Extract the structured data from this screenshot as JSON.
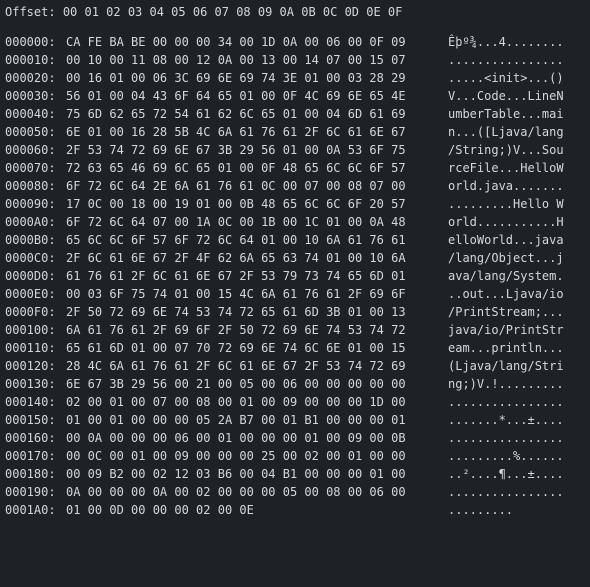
{
  "header": {
    "label": "Offset:",
    "columns": "00 01 02 03 04 05 06 07 08 09 0A 0B 0C 0D 0E 0F"
  },
  "rows": [
    {
      "offset": "000000:",
      "hex": "CA FE BA BE 00 00 00 34 00 1D 0A 00 06 00 0F 09",
      "ascii": "Êþº¾...4........"
    },
    {
      "offset": "000010:",
      "hex": "00 10 00 11 08 00 12 0A 00 13 00 14 07 00 15 07",
      "ascii": "................"
    },
    {
      "offset": "000020:",
      "hex": "00 16 01 00 06 3C 69 6E 69 74 3E 01 00 03 28 29",
      "ascii": ".....<init>...()"
    },
    {
      "offset": "000030:",
      "hex": "56 01 00 04 43 6F 64 65 01 00 0F 4C 69 6E 65 4E",
      "ascii": "V...Code...LineN"
    },
    {
      "offset": "000040:",
      "hex": "75 6D 62 65 72 54 61 62 6C 65 01 00 04 6D 61 69",
      "ascii": "umberTable...mai"
    },
    {
      "offset": "000050:",
      "hex": "6E 01 00 16 28 5B 4C 6A 61 76 61 2F 6C 61 6E 67",
      "ascii": "n...([Ljava/lang"
    },
    {
      "offset": "000060:",
      "hex": "2F 53 74 72 69 6E 67 3B 29 56 01 00 0A 53 6F 75",
      "ascii": "/String;)V...Sou"
    },
    {
      "offset": "000070:",
      "hex": "72 63 65 46 69 6C 65 01 00 0F 48 65 6C 6C 6F 57",
      "ascii": "rceFile...HelloW"
    },
    {
      "offset": "000080:",
      "hex": "6F 72 6C 64 2E 6A 61 76 61 0C 00 07 00 08 07 00",
      "ascii": "orld.java......."
    },
    {
      "offset": "000090:",
      "hex": "17 0C 00 18 00 19 01 00 0B 48 65 6C 6C 6F 20 57",
      "ascii": ".........Hello W"
    },
    {
      "offset": "0000A0:",
      "hex": "6F 72 6C 64 07 00 1A 0C 00 1B 00 1C 01 00 0A 48",
      "ascii": "orld...........H"
    },
    {
      "offset": "0000B0:",
      "hex": "65 6C 6C 6F 57 6F 72 6C 64 01 00 10 6A 61 76 61",
      "ascii": "elloWorld...java"
    },
    {
      "offset": "0000C0:",
      "hex": "2F 6C 61 6E 67 2F 4F 62 6A 65 63 74 01 00 10 6A",
      "ascii": "/lang/Object...j"
    },
    {
      "offset": "0000D0:",
      "hex": "61 76 61 2F 6C 61 6E 67 2F 53 79 73 74 65 6D 01",
      "ascii": "ava/lang/System."
    },
    {
      "offset": "0000E0:",
      "hex": "00 03 6F 75 74 01 00 15 4C 6A 61 76 61 2F 69 6F",
      "ascii": "..out...Ljava/io"
    },
    {
      "offset": "0000F0:",
      "hex": "2F 50 72 69 6E 74 53 74 72 65 61 6D 3B 01 00 13",
      "ascii": "/PrintStream;..."
    },
    {
      "offset": "000100:",
      "hex": "6A 61 76 61 2F 69 6F 2F 50 72 69 6E 74 53 74 72",
      "ascii": "java/io/PrintStr"
    },
    {
      "offset": "000110:",
      "hex": "65 61 6D 01 00 07 70 72 69 6E 74 6C 6E 01 00 15",
      "ascii": "eam...println..."
    },
    {
      "offset": "000120:",
      "hex": "28 4C 6A 61 76 61 2F 6C 61 6E 67 2F 53 74 72 69",
      "ascii": "(Ljava/lang/Stri"
    },
    {
      "offset": "000130:",
      "hex": "6E 67 3B 29 56 00 21 00 05 00 06 00 00 00 00 00",
      "ascii": "ng;)V.!........."
    },
    {
      "offset": "000140:",
      "hex": "02 00 01 00 07 00 08 00 01 00 09 00 00 00 1D 00",
      "ascii": "................"
    },
    {
      "offset": "000150:",
      "hex": "01 00 01 00 00 00 05 2A B7 00 01 B1 00 00 00 01",
      "ascii": ".......*...±...."
    },
    {
      "offset": "000160:",
      "hex": "00 0A 00 00 00 06 00 01 00 00 00 01 00 09 00 0B",
      "ascii": "................"
    },
    {
      "offset": "000170:",
      "hex": "00 0C 00 01 00 09 00 00 00 25 00 02 00 01 00 00",
      "ascii": ".........%......"
    },
    {
      "offset": "000180:",
      "hex": "00 09 B2 00 02 12 03 B6 00 04 B1 00 00 00 01 00",
      "ascii": "..²....¶...±...."
    },
    {
      "offset": "000190:",
      "hex": "0A 00 00 00 0A 00 02 00 00 00 05 00 08 00 06 00",
      "ascii": "................"
    },
    {
      "offset": "0001A0:",
      "hex": "01 00 0D 00 00 00 02 00 0E",
      "ascii": "........."
    }
  ],
  "colors": {
    "background": "#1e2227",
    "text": "#d4d7db"
  }
}
